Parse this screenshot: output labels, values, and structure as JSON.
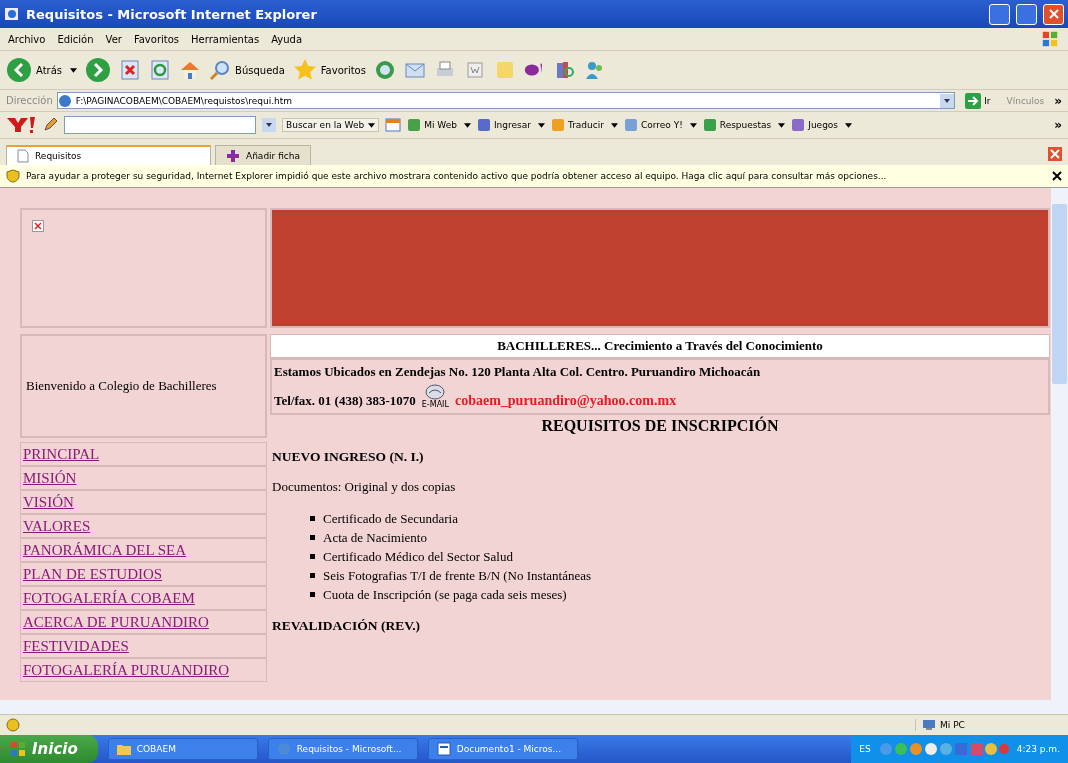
{
  "window": {
    "title": "Requisitos - Microsoft Internet Explorer"
  },
  "menu": [
    "Archivo",
    "Edición",
    "Ver",
    "Favoritos",
    "Herramientas",
    "Ayuda"
  ],
  "toolbar": {
    "back": "Atrás",
    "search": "Búsqueda",
    "favorites": "Favoritos"
  },
  "address": {
    "label": "Dirección",
    "value": "F:\\PAGINACOBAEM\\COBAEM\\requistos\\requi.htm",
    "go": "Ir",
    "links": "Vínculos",
    "more": "»"
  },
  "yahoo_bar": {
    "search_button": "Buscar en la Web",
    "items": [
      "Mi Web",
      "Ingresar",
      "Traducir",
      "Correo Y!",
      "Respuestas",
      "Juegos"
    ],
    "more": "»"
  },
  "tabs": [
    {
      "label": "Requisitos",
      "selected": true
    },
    {
      "label": "Añadir ficha",
      "selected": false
    }
  ],
  "info_bar": "Para ayudar a proteger su seguridad, Internet Explorer impidió que este archivo mostrara contenido activo que podría obtener acceso al equipo. Haga clic aquí para consultar más opciones...",
  "page": {
    "welcome": "Bienvenido a Colegio de Bachilleres",
    "nav": [
      "PRINCIPAL",
      "MISIÓN",
      "VISIÓN",
      "VALORES",
      "PANORÁMICA DEL SEA",
      "PLAN DE ESTUDIOS",
      "FOTOGALERÍA COBAEM",
      "ACERCA DE PURUANDIRO",
      "FESTIVIDADES",
      "FOTOGALERÍA PURUANDIRO"
    ],
    "slogan": "BACHILLERES... Crecimiento a Través del Conocimiento",
    "address": "Estamos Ubicados en Zendejas No. 120 Planta Alta Col. Centro. Puruandiro Michoacán",
    "phone": "Tel/fax. 01 (438) 383-1070",
    "email_icon_label": "E-MAIL",
    "email": "cobaem_puruandiro@yahoo.com.mx",
    "heading": "REQUISITOS DE INSCRIPCIÓN",
    "section1": "NUEVO INGRESO (N. I.)",
    "docs": "Documentos: Original y dos copias",
    "list": [
      "Certificado de Secundaria",
      "Acta de Nacimiento",
      "Certificado Médico del Sector Salud",
      "Seis Fotografias T/I de frente B/N (No Instantáneas",
      "Cuota de Inscripción (se paga cada seis meses)"
    ],
    "section2": "REVALIDACIÓN (REV.)"
  },
  "status_bar": {
    "zone": "Mi PC"
  },
  "taskbar": {
    "start": "Inicio",
    "items": [
      {
        "label": "COBAEM",
        "kind": "folder"
      },
      {
        "label": "Requisitos - Microsoft...",
        "kind": "browser"
      },
      {
        "label": "Documento1 - Micros...",
        "kind": "word"
      }
    ],
    "lang": "ES",
    "clock": "4:23 p.m."
  }
}
